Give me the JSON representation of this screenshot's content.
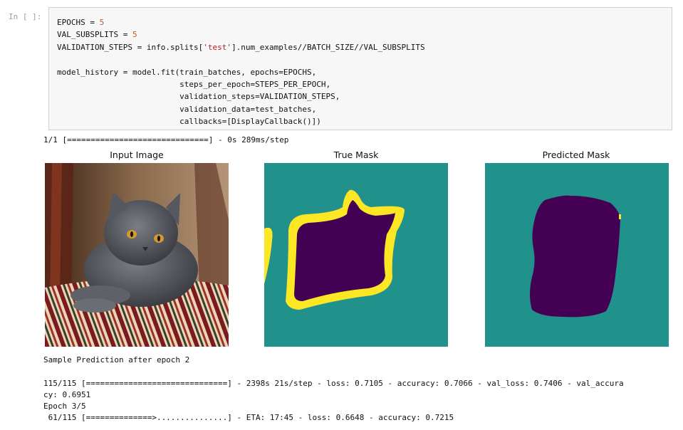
{
  "cell": {
    "prompt": "In [ ]:",
    "code_lines": [
      {
        "parts": [
          {
            "t": "EPOCHS = ",
            "c": "plain"
          },
          {
            "t": "5",
            "c": "num"
          }
        ]
      },
      {
        "parts": [
          {
            "t": "VAL_SUBSPLITS = ",
            "c": "plain"
          },
          {
            "t": "5",
            "c": "num"
          }
        ]
      },
      {
        "parts": [
          {
            "t": "VALIDATION_STEPS = info.splits[",
            "c": "plain"
          },
          {
            "t": "'test'",
            "c": "str"
          },
          {
            "t": "].num_examples//BATCH_SIZE//VAL_SUBSPLITS",
            "c": "plain"
          }
        ]
      },
      {
        "parts": [
          {
            "t": "",
            "c": "plain"
          }
        ]
      },
      {
        "parts": [
          {
            "t": "model_history = model.fit(train_batches, epochs=EPOCHS,",
            "c": "plain"
          }
        ]
      },
      {
        "parts": [
          {
            "t": "                          steps_per_epoch=STEPS_PER_EPOCH,",
            "c": "plain"
          }
        ]
      },
      {
        "parts": [
          {
            "t": "                          validation_steps=VALIDATION_STEPS,",
            "c": "plain"
          }
        ]
      },
      {
        "parts": [
          {
            "t": "                          validation_data=test_batches,",
            "c": "plain"
          }
        ]
      },
      {
        "parts": [
          {
            "t": "                          callbacks=[DisplayCallback()])",
            "c": "plain"
          }
        ]
      }
    ]
  },
  "output": {
    "progress_line": "1/1 [==============================] - 0s 289ms/step",
    "figure_titles": [
      "Input Image",
      "True Mask",
      "Predicted Mask"
    ],
    "sample_text": "Sample Prediction after epoch 2",
    "epoch_log_line1": "115/115 [==============================] - 2398s 21s/step - loss: 0.7105 - accuracy: 0.7066 - val_loss: 0.7406 - val_accura",
    "epoch_log_line2": "cy: 0.6951",
    "epoch_header": "Epoch 3/5",
    "current_progress": " 61/115 [==============>...............] - ETA: 17:45 - loss: 0.6648 - accuracy: 0.7215"
  },
  "colors": {
    "mask_background": "#21918c",
    "mask_object": "#440154",
    "mask_border": "#fde725",
    "number_literal": "#c45a2c",
    "string_literal": "#b22222"
  }
}
